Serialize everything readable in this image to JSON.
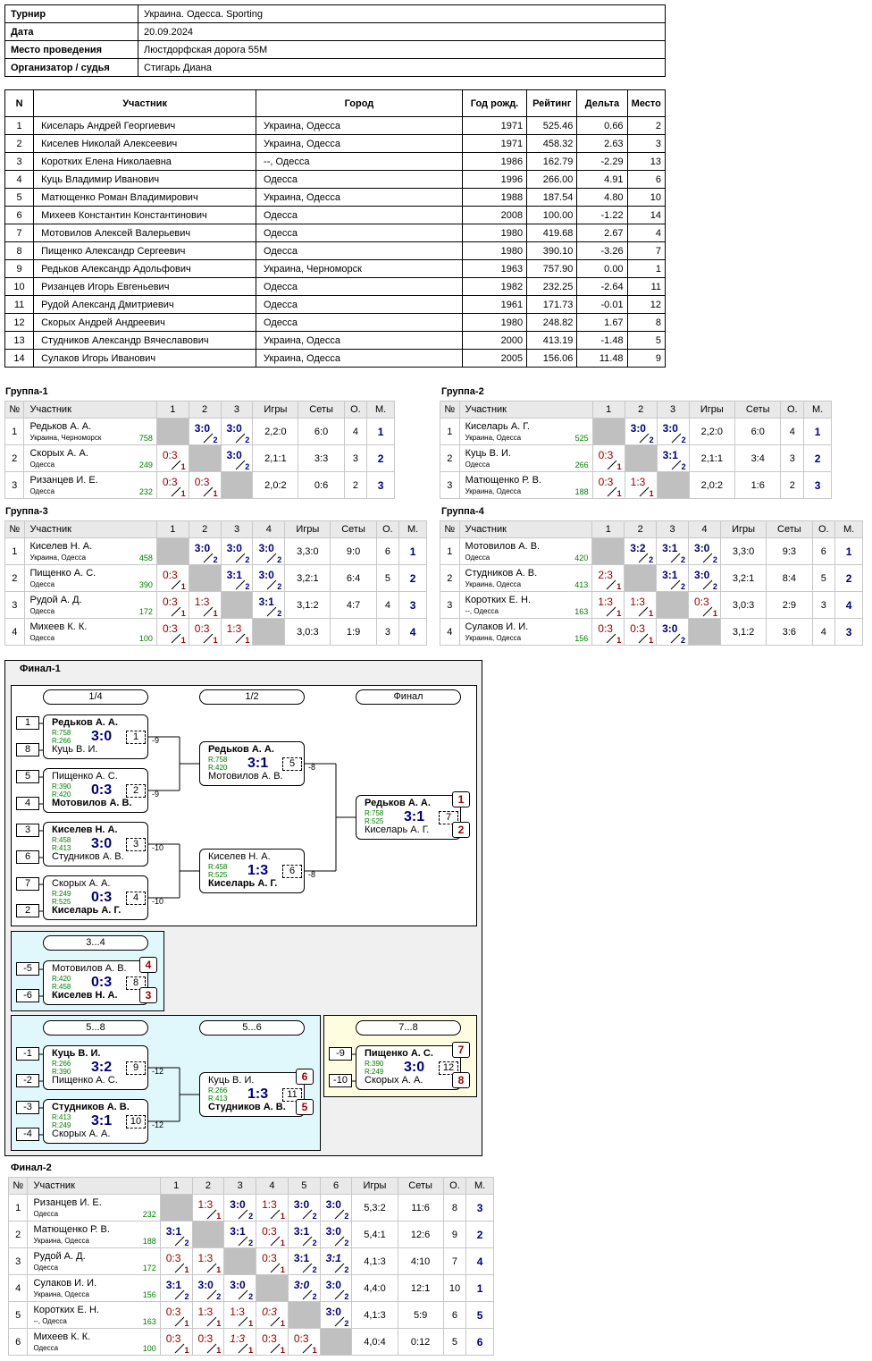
{
  "info": [
    {
      "k": "Турнир",
      "v": "Украина. Одесса. Sporting"
    },
    {
      "k": "Дата",
      "v": "20.09.2024"
    },
    {
      "k": "Место проведения",
      "v": "Люстдорфская дорога 55М"
    },
    {
      "k": "Организатор / судья",
      "v": "Стигарь Диана"
    }
  ],
  "main_headers": [
    "N",
    "Участник",
    "Город",
    "Год рожд.",
    "Рейтинг",
    "Дельта",
    "Место"
  ],
  "main_rows": [
    [
      "1",
      "Киселарь Андрей Георгиевич",
      "Украина, Одесса",
      "1971",
      "525.46",
      "0.66",
      "2"
    ],
    [
      "2",
      "Киселев Николай Алексеевич",
      "Украина, Одесса",
      "1971",
      "458.32",
      "2.63",
      "3"
    ],
    [
      "3",
      "Коротких Елена Николаевна",
      "--, Одесса",
      "1986",
      "162.79",
      "-2.29",
      "13"
    ],
    [
      "4",
      "Куць Владимир Иванович",
      "Одесса",
      "1996",
      "266.00",
      "4.91",
      "6"
    ],
    [
      "5",
      "Матющенко Роман Владимирович",
      "Украина, Одесса",
      "1988",
      "187.54",
      "4.80",
      "10"
    ],
    [
      "6",
      "Михеев Константин Константинович",
      "Одесса",
      "2008",
      "100.00",
      "-1.22",
      "14"
    ],
    [
      "7",
      "Мотовилов Алексей Валерьевич",
      "Одесса",
      "1980",
      "419.68",
      "2.67",
      "4"
    ],
    [
      "8",
      "Пищенко Александр Сергеевич",
      "Одесса",
      "1980",
      "390.10",
      "-3.26",
      "7"
    ],
    [
      "9",
      "Редьков Александр Адольфович",
      "Украина, Черноморск",
      "1963",
      "757.90",
      "0.00",
      "1"
    ],
    [
      "10",
      "Ризанцев Игорь Евгеньевич",
      "Одесса",
      "1982",
      "232.25",
      "-2.64",
      "11"
    ],
    [
      "11",
      "Рудой Александ Дмитриевич",
      "Одесса",
      "1961",
      "171.73",
      "-0.01",
      "12"
    ],
    [
      "12",
      "Скорых Андрей Андреевич",
      "Одесса",
      "1980",
      "248.82",
      "1.67",
      "8"
    ],
    [
      "13",
      "Студников Александр Вячеславович",
      "Украина, Одесса",
      "2000",
      "413.19",
      "-1.48",
      "5"
    ],
    [
      "14",
      "Сулаков Игорь Иванович",
      "Украина, Одесса",
      "2005",
      "156.06",
      "11.48",
      "9"
    ]
  ],
  "group_headers": {
    "num": "№",
    "player": "Участник",
    "games": "Игры",
    "sets": "Сеты",
    "points": "О.",
    "place": "М."
  },
  "groups": [
    {
      "title": "Группа-1",
      "players": [
        {
          "n": "1",
          "name": "Редьков А. А.",
          "city": "Украина, Черноморск",
          "rating": "758",
          "cells": [
            null,
            [
              "3:0",
              "2",
              "w"
            ],
            [
              "3:0",
              "2",
              "w"
            ]
          ],
          "games": "2,2:0",
          "sets": "6:0",
          "pts": "4",
          "place": "1"
        },
        {
          "n": "2",
          "name": "Скорых А. А.",
          "city": "Одесса",
          "rating": "249",
          "cells": [
            [
              "0:3",
              "1",
              "l"
            ],
            null,
            [
              "3:0",
              "2",
              "w"
            ]
          ],
          "games": "2,1:1",
          "sets": "3:3",
          "pts": "3",
          "place": "2"
        },
        {
          "n": "3",
          "name": "Ризанцев И. Е.",
          "city": "Одесса",
          "rating": "232",
          "cells": [
            [
              "0:3",
              "1",
              "l"
            ],
            [
              "0:3",
              "1",
              "l"
            ],
            null
          ],
          "games": "2,0:2",
          "sets": "0:6",
          "pts": "2",
          "place": "3"
        }
      ]
    },
    {
      "title": "Группа-2",
      "players": [
        {
          "n": "1",
          "name": "Киселарь А. Г.",
          "city": "Украина, Одесса",
          "rating": "525",
          "cells": [
            null,
            [
              "3:0",
              "2",
              "w"
            ],
            [
              "3:0",
              "2",
              "w"
            ]
          ],
          "games": "2,2:0",
          "sets": "6:0",
          "pts": "4",
          "place": "1"
        },
        {
          "n": "2",
          "name": "Куць В. И.",
          "city": "Одесса",
          "rating": "266",
          "cells": [
            [
              "0:3",
              "1",
              "l"
            ],
            null,
            [
              "3:1",
              "2",
              "w"
            ]
          ],
          "games": "2,1:1",
          "sets": "3:4",
          "pts": "3",
          "place": "2"
        },
        {
          "n": "3",
          "name": "Матющенко Р. В.",
          "city": "Украина, Одесса",
          "rating": "188",
          "cells": [
            [
              "0:3",
              "1",
              "l"
            ],
            [
              "1:3",
              "1",
              "l"
            ],
            null
          ],
          "games": "2,0:2",
          "sets": "1:6",
          "pts": "2",
          "place": "3"
        }
      ]
    },
    {
      "title": "Группа-3",
      "players": [
        {
          "n": "1",
          "name": "Киселев Н. А.",
          "city": "Украина, Одесса",
          "rating": "458",
          "cells": [
            null,
            [
              "3:0",
              "2",
              "w"
            ],
            [
              "3:0",
              "2",
              "w"
            ],
            [
              "3:0",
              "2",
              "w"
            ]
          ],
          "games": "3,3:0",
          "sets": "9:0",
          "pts": "6",
          "place": "1"
        },
        {
          "n": "2",
          "name": "Пищенко А. С.",
          "city": "Одесса",
          "rating": "390",
          "cells": [
            [
              "0:3",
              "1",
              "l"
            ],
            null,
            [
              "3:1",
              "2",
              "w"
            ],
            [
              "3:0",
              "2",
              "w"
            ]
          ],
          "games": "3,2:1",
          "sets": "6:4",
          "pts": "5",
          "place": "2"
        },
        {
          "n": "3",
          "name": "Рудой А. Д.",
          "city": "Одесса",
          "rating": "172",
          "cells": [
            [
              "0:3",
              "1",
              "l"
            ],
            [
              "1:3",
              "1",
              "l"
            ],
            null,
            [
              "3:1",
              "2",
              "w"
            ]
          ],
          "games": "3,1:2",
          "sets": "4:7",
          "pts": "4",
          "place": "3"
        },
        {
          "n": "4",
          "name": "Михеев К. К.",
          "city": "Одесса",
          "rating": "100",
          "cells": [
            [
              "0:3",
              "1",
              "l"
            ],
            [
              "0:3",
              "1",
              "l"
            ],
            [
              "1:3",
              "1",
              "l"
            ],
            null
          ],
          "games": "3,0:3",
          "sets": "1:9",
          "pts": "3",
          "place": "4"
        }
      ]
    },
    {
      "title": "Группа-4",
      "players": [
        {
          "n": "1",
          "name": "Мотовилов А. В.",
          "city": "Одесса",
          "rating": "420",
          "cells": [
            null,
            [
              "3:2",
              "2",
              "w"
            ],
            [
              "3:1",
              "2",
              "w"
            ],
            [
              "3:0",
              "2",
              "w"
            ]
          ],
          "games": "3,3:0",
          "sets": "9:3",
          "pts": "6",
          "place": "1"
        },
        {
          "n": "2",
          "name": "Студников А. В.",
          "city": "Украина, Одесса",
          "rating": "413",
          "cells": [
            [
              "2:3",
              "1",
              "l"
            ],
            null,
            [
              "3:1",
              "2",
              "w"
            ],
            [
              "3:0",
              "2",
              "w"
            ]
          ],
          "games": "3,2:1",
          "sets": "8:4",
          "pts": "5",
          "place": "2"
        },
        {
          "n": "3",
          "name": "Коротких Е. Н.",
          "city": "--, Одесса",
          "rating": "163",
          "cells": [
            [
              "1:3",
              "1",
              "l"
            ],
            [
              "1:3",
              "1",
              "l"
            ],
            null,
            [
              "0:3",
              "1",
              "l"
            ]
          ],
          "games": "3,0:3",
          "sets": "2:9",
          "pts": "3",
          "place": "4"
        },
        {
          "n": "4",
          "name": "Сулаков И. И.",
          "city": "Украина, Одесса",
          "rating": "156",
          "cells": [
            [
              "0:3",
              "1",
              "l"
            ],
            [
              "0:3",
              "1",
              "l"
            ],
            [
              "3:0",
              "2",
              "w"
            ],
            null
          ],
          "games": "3,1:2",
          "sets": "3:6",
          "pts": "4",
          "place": "3"
        }
      ]
    },
    {
      "title": "Финал-2",
      "players": [
        {
          "n": "1",
          "name": "Ризанцев И. Е.",
          "city": "Одесса",
          "rating": "232",
          "cells": [
            null,
            [
              "1:3",
              "1",
              "l"
            ],
            [
              "3:0",
              "2",
              "w"
            ],
            [
              "1:3",
              "1",
              "l"
            ],
            [
              "3:0",
              "2",
              "w"
            ],
            [
              "3:0",
              "2",
              "w"
            ]
          ],
          "games": "5,3:2",
          "sets": "11:6",
          "pts": "8",
          "place": "3"
        },
        {
          "n": "2",
          "name": "Матющенко Р. В.",
          "city": "Украина, Одесса",
          "rating": "188",
          "cells": [
            [
              "3:1",
              "2",
              "w"
            ],
            null,
            [
              "3:1",
              "2",
              "w"
            ],
            [
              "0:3",
              "1",
              "l"
            ],
            [
              "3:1",
              "2",
              "w"
            ],
            [
              "3:0",
              "2",
              "w"
            ]
          ],
          "games": "5,4:1",
          "sets": "12:6",
          "pts": "9",
          "place": "2"
        },
        {
          "n": "3",
          "name": "Рудой А. Д.",
          "city": "Одесса",
          "rating": "172",
          "cells": [
            [
              "0:3",
              "1",
              "l"
            ],
            [
              "1:3",
              "1",
              "l"
            ],
            null,
            [
              "0:3",
              "1",
              "l"
            ],
            [
              "3:1",
              "2",
              "w"
            ],
            [
              "3:1",
              "2",
              "wi"
            ]
          ],
          "games": "4,1:3",
          "sets": "4:10",
          "pts": "7",
          "place": "4"
        },
        {
          "n": "4",
          "name": "Сулаков И. И.",
          "city": "Украина, Одесса",
          "rating": "156",
          "cells": [
            [
              "3:1",
              "2",
              "w"
            ],
            [
              "3:0",
              "2",
              "w"
            ],
            [
              "3:0",
              "2",
              "w"
            ],
            null,
            [
              "3:0",
              "2",
              "wi"
            ],
            [
              "3:0",
              "2",
              "w"
            ]
          ],
          "games": "4,4:0",
          "sets": "12:1",
          "pts": "10",
          "place": "1"
        },
        {
          "n": "5",
          "name": "Коротких Е. Н.",
          "city": "--, Одесса",
          "rating": "163",
          "cells": [
            [
              "0:3",
              "1",
              "l"
            ],
            [
              "1:3",
              "1",
              "l"
            ],
            [
              "1:3",
              "1",
              "l"
            ],
            [
              "0:3",
              "1",
              "li"
            ],
            null,
            [
              "3:0",
              "2",
              "w"
            ]
          ],
          "games": "4,1:3",
          "sets": "5:9",
          "pts": "6",
          "place": "5"
        },
        {
          "n": "6",
          "name": "Михеев К. К.",
          "city": "Одесса",
          "rating": "100",
          "cells": [
            [
              "0:3",
              "1",
              "l"
            ],
            [
              "0:3",
              "1",
              "l"
            ],
            [
              "1:3",
              "1",
              "li"
            ],
            [
              "0:3",
              "1",
              "l"
            ],
            [
              "0:3",
              "1",
              "l"
            ],
            null
          ],
          "games": "4,0:4",
          "sets": "0:12",
          "pts": "5",
          "place": "6"
        }
      ]
    }
  ],
  "final1": {
    "title": "Финал-1",
    "rounds": [
      "1/4",
      "1/2",
      "Финал",
      "3...4",
      "5...8",
      "5...6",
      "7...8"
    ],
    "seeds": [
      "1",
      "8",
      "5",
      "4",
      "3",
      "6",
      "7",
      "2",
      "-5",
      "-6",
      "-1",
      "-2",
      "-3",
      "-4",
      "-9",
      "-10"
    ],
    "matches": [
      {
        "p1": "Редьков А. А.",
        "r1": "R:758",
        "p2": "Куць В. И.",
        "r2": "R:266",
        "score": "3:0",
        "num": "1",
        "win": 1,
        "loser": "-9"
      },
      {
        "p1": "Пищенко А. С.",
        "r1": "R:390",
        "p2": "Мотовилов А. В.",
        "r2": "R:420",
        "score": "0:3",
        "num": "2",
        "win": 2,
        "loser": "-9"
      },
      {
        "p1": "Киселев Н. А.",
        "r1": "R:458",
        "p2": "Студников А. В.",
        "r2": "R:413",
        "score": "3:0",
        "num": "3",
        "win": 1,
        "loser": "-10"
      },
      {
        "p1": "Скорых А. А.",
        "r1": "R:249",
        "p2": "Киселарь А. Г.",
        "r2": "R:525",
        "score": "0:3",
        "num": "4",
        "win": 2,
        "loser": "-10"
      },
      {
        "p1": "Редьков А. А.",
        "r1": "R:758",
        "p2": "Мотовилов А. В.",
        "r2": "R:420",
        "score": "3:1",
        "num": "5",
        "win": 1,
        "loser": "-8"
      },
      {
        "p1": "Киселев Н. А.",
        "r1": "R:458",
        "p2": "Киселарь А. Г.",
        "r2": "R:525",
        "score": "1:3",
        "num": "6",
        "win": 2,
        "loser": "-8"
      },
      {
        "p1": "Редьков А. А.",
        "r1": "R:758",
        "p2": "Киселарь А. Г.",
        "r2": "R:525",
        "score": "3:1",
        "num": "7",
        "win": 1,
        "place1": "1",
        "place2": "2"
      },
      {
        "p1": "Мотовилов А. В.",
        "r1": "R:420",
        "p2": "Киселев Н. А.",
        "r2": "R:458",
        "score": "0:3",
        "num": "8",
        "win": 2,
        "place1": "4",
        "place2": "3"
      },
      {
        "p1": "Куць В. И.",
        "r1": "R:266",
        "p2": "Пищенко А. С.",
        "r2": "R:390",
        "score": "3:2",
        "num": "9",
        "win": 1,
        "loser": "-12"
      },
      {
        "p1": "Студников А. В.",
        "r1": "R:413",
        "p2": "Скорых А. А.",
        "r2": "R:249",
        "score": "3:1",
        "num": "10",
        "win": 1,
        "loser": "-12"
      },
      {
        "p1": "Куць В. И.",
        "r1": "R:266",
        "p2": "Студников А. В.",
        "r2": "R:413",
        "score": "1:3",
        "num": "11",
        "win": 2,
        "place1": "6",
        "place2": "5"
      },
      {
        "p1": "Пищенко А. С.",
        "r1": "R:390",
        "p2": "Скорых А. А.",
        "r2": "R:249",
        "score": "3:0",
        "num": "12",
        "win": 1,
        "place1": "7",
        "place2": "8"
      }
    ]
  }
}
